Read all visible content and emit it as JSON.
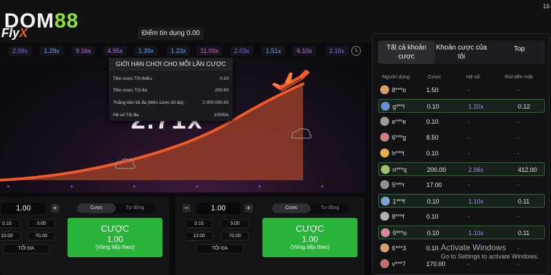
{
  "top": {
    "logo_main": "DOM",
    "logo_accent": "88",
    "game_logo_a": "Fly",
    "game_logo_b": "X",
    "clock_fragment": "16",
    "credit_label": "Điểm tín dụng 0.00"
  },
  "history": [
    {
      "value": "2.09x",
      "color": "#7b6cff"
    },
    {
      "value": "1.29x",
      "color": "#5aa6ff"
    },
    {
      "value": "9.16x",
      "color": "#d466ff"
    },
    {
      "value": "4.95x",
      "color": "#b26bff"
    },
    {
      "value": "1.39x",
      "color": "#5aa6ff"
    },
    {
      "value": "1.23x",
      "color": "#5aa6ff"
    },
    {
      "value": "11.09x",
      "color": "#e05ae0"
    },
    {
      "value": "2.03x",
      "color": "#7b6cff"
    },
    {
      "value": "1.51x",
      "color": "#5aa6ff"
    },
    {
      "value": "6.10x",
      "color": "#d466ff"
    },
    {
      "value": "2.16x",
      "color": "#7b6cff"
    }
  ],
  "stage": {
    "multiplier": "2.71x",
    "curve_color": "#f05a28",
    "fill_color": "#b84a2a"
  },
  "limits": {
    "title": "GIỚI HẠN CHƠI CHO MỖI LẦN CƯỢC",
    "rows": [
      {
        "label": "Tiền cược Tối thiểu:",
        "value": "0.10"
      },
      {
        "label": "Tiền cược Tối đa:",
        "value": "200.00"
      },
      {
        "label": "Thắng tiền tối đa (Mức cược tối đa):",
        "value": "2 000 000.00"
      },
      {
        "label": "Hệ số Tối đa:",
        "value": "10000x"
      }
    ]
  },
  "panels": [
    {
      "amount": "1.00",
      "plus": "+",
      "minus": "",
      "mode_active": "Cược",
      "mode_inactive": "Tự động",
      "quick": [
        "0.10",
        "3.00",
        "10.00",
        "70.00"
      ],
      "max_label": "TỐI ĐA",
      "bet_label": "CƯỢC",
      "bet_amount": "1.00",
      "bet_note": "(Vòng tiếp theo)"
    },
    {
      "amount": "1.00",
      "plus": "+",
      "minus": "−",
      "mode_active": "Cược",
      "mode_inactive": "Tự động",
      "quick": [
        "0.10",
        "3.00",
        "13.00",
        "70.00"
      ],
      "max_label": "TỐI ĐA",
      "bet_label": "CƯỢC",
      "bet_amount": "1.00",
      "bet_note": "(Vòng tiếp theo)"
    }
  ],
  "side": {
    "tabs": [
      "Tất cả khoản cược",
      "Khoản cược của tôi",
      "Top"
    ],
    "columns": [
      "Người dùng",
      "Cược",
      "Hệ số",
      "Rút tiền mặt"
    ],
    "rows": [
      {
        "user": "8***o",
        "bet": "1.50",
        "coef": "-",
        "out": "-",
        "win": false,
        "avatar": "#d9a06a"
      },
      {
        "user": "g***l",
        "bet": "0.10",
        "coef": "1.20x",
        "out": "0.12",
        "win": true,
        "avatar": "#6a8dd9"
      },
      {
        "user": "e***e",
        "bet": "0.10",
        "coef": "-",
        "out": "-",
        "win": false,
        "avatar": "#9a9a9a"
      },
      {
        "user": "6***g",
        "bet": "8.50",
        "coef": "-",
        "out": "-",
        "win": false,
        "avatar": "#c98080"
      },
      {
        "user": "h***t",
        "bet": "0.10",
        "coef": "-",
        "out": "-",
        "win": false,
        "avatar": "#e0b050"
      },
      {
        "user": "n***q",
        "bet": "200.00",
        "coef": "2.06x",
        "out": "412.00",
        "win": true,
        "avatar": "#a0c070"
      },
      {
        "user": "5***r",
        "bet": "17.00",
        "coef": "-",
        "out": "-",
        "win": false,
        "avatar": "#909090"
      },
      {
        "user": "1***f",
        "bet": "0.10",
        "coef": "1.10x",
        "out": "0.11",
        "win": true,
        "avatar": "#80a0d0"
      },
      {
        "user": "8***f",
        "bet": "0.10",
        "coef": "-",
        "out": "-",
        "win": false,
        "avatar": "#b0b0b0"
      },
      {
        "user": "9***o",
        "bet": "0.10",
        "coef": "1.10x",
        "out": "0.11",
        "win": true,
        "avatar": "#d08aa0"
      },
      {
        "user": "6***3",
        "bet": "0.10",
        "coef": "-",
        "out": "-",
        "win": false,
        "avatar": "#d0a070"
      },
      {
        "user": "v***7",
        "bet": "170.00",
        "coef": "-",
        "out": "-",
        "win": false,
        "avatar": "#c07070"
      }
    ]
  },
  "watermark": {
    "line1": "Activate Windows",
    "line2": "Go to Settings to activate Windows."
  }
}
